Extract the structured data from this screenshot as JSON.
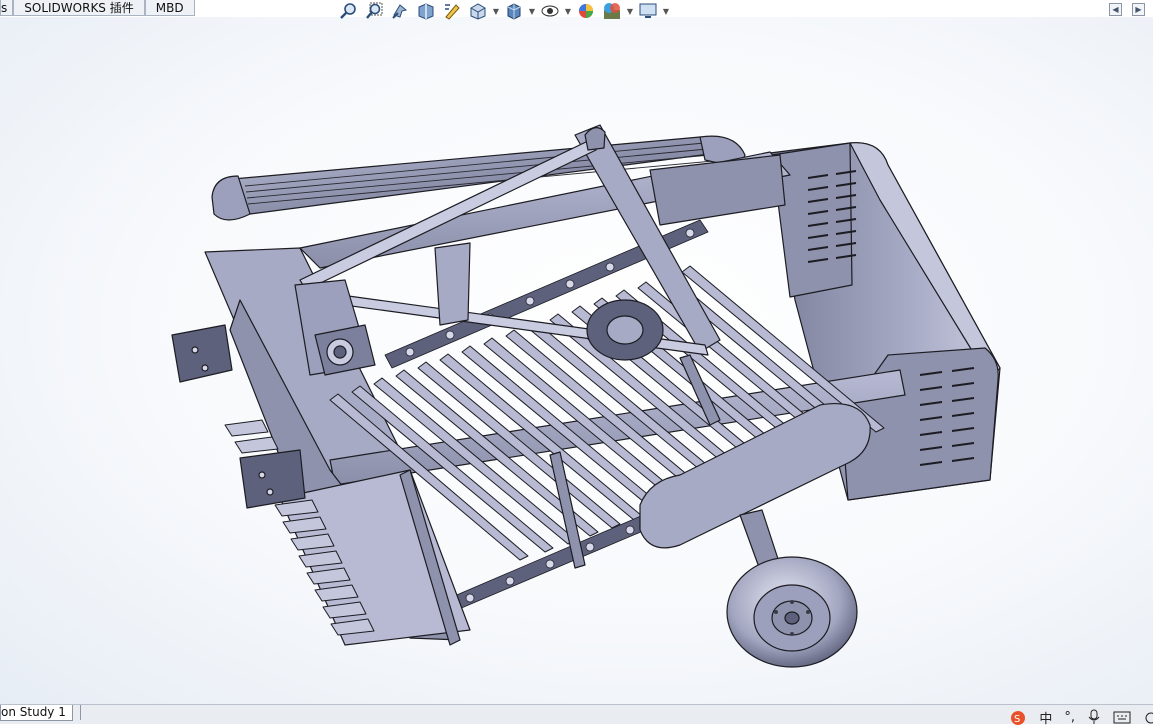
{
  "tabs": [
    {
      "label": "s"
    },
    {
      "label": "SOLIDWORKS 插件"
    },
    {
      "label": "MBD"
    }
  ],
  "hud_toolbar": [
    {
      "icon": "zoom-to-fit-icon"
    },
    {
      "icon": "zoom-to-area-icon"
    },
    {
      "icon": "previous-view-icon"
    },
    {
      "icon": "section-view-icon"
    },
    {
      "icon": "dynamic-annotation-icon"
    },
    {
      "icon": "view-orientation-icon"
    },
    {
      "icon": "display-style-icon"
    },
    {
      "icon": "hide-show-items-icon"
    },
    {
      "icon": "edit-appearance-icon"
    },
    {
      "icon": "apply-scene-icon"
    },
    {
      "icon": "view-settings-icon"
    }
  ],
  "bottom": {
    "study_tab": "on Study 1"
  },
  "tray": {
    "ime_label": "中",
    "punct_label": "°,"
  },
  "colors": {
    "model_fill": "#8a8ea8",
    "model_light": "#c9cbe0",
    "edge": "#1c1c22",
    "ime_logo": "#e8522a"
  }
}
